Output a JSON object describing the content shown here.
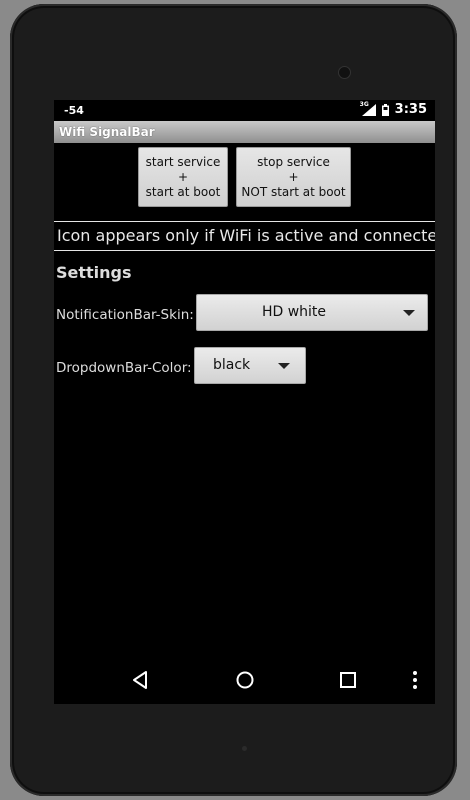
{
  "status_bar": {
    "signal_strength": "-54",
    "network_type": "3G",
    "time": "3:35"
  },
  "app": {
    "title": "Wifi SignalBar"
  },
  "buttons": {
    "start": {
      "line1": "start service",
      "line2": "+",
      "line3": "start at boot"
    },
    "stop": {
      "line1": "stop service",
      "line2": "+",
      "line3": "NOT start at boot"
    }
  },
  "info_text": "Icon appears only if WiFi is active and connected.",
  "settings": {
    "title": "Settings",
    "notification_skin": {
      "label": "NotificationBar-Skin:",
      "value": "HD white"
    },
    "dropdown_color": {
      "label": "DropdownBar-Color:",
      "value": "black"
    }
  },
  "nav_bar": {
    "icons": [
      "back-icon",
      "home-icon",
      "recents-icon",
      "overflow-menu-icon"
    ]
  },
  "colors": {
    "screen_bg": "#000000",
    "text": "#dddddd",
    "button_bg": "#d9d9d9",
    "title_bar": "#a9a9a9"
  }
}
